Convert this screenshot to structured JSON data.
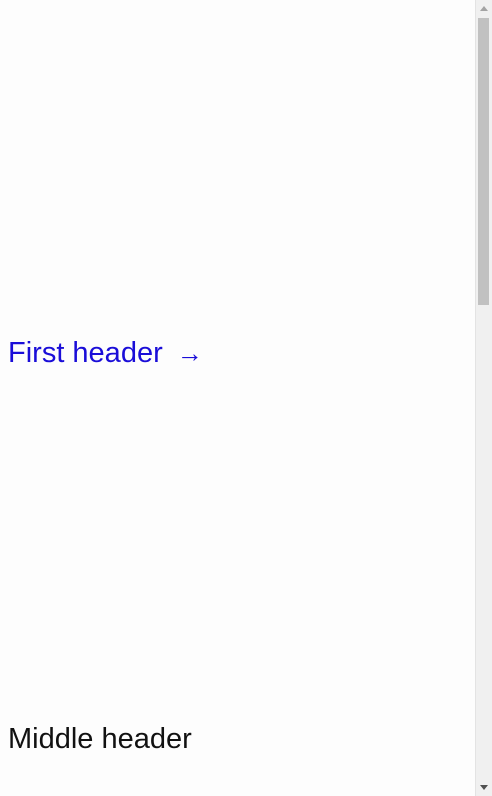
{
  "page": {
    "first_header": {
      "label": "First header",
      "arrow": "→"
    },
    "middle_header": {
      "label": "Middle header"
    }
  },
  "colors": {
    "link": "#1a0dd8",
    "text": "#111111",
    "background": "#fdfdfd",
    "scrollbar_track": "#f0f0f0",
    "scrollbar_thumb": "#c1c1c1"
  },
  "icons": {
    "first_header_arrow": "right-arrow-icon",
    "scroll_up": "chevron-up-icon",
    "scroll_down": "chevron-down-icon"
  },
  "scroll": {
    "position_fraction": 0
  }
}
